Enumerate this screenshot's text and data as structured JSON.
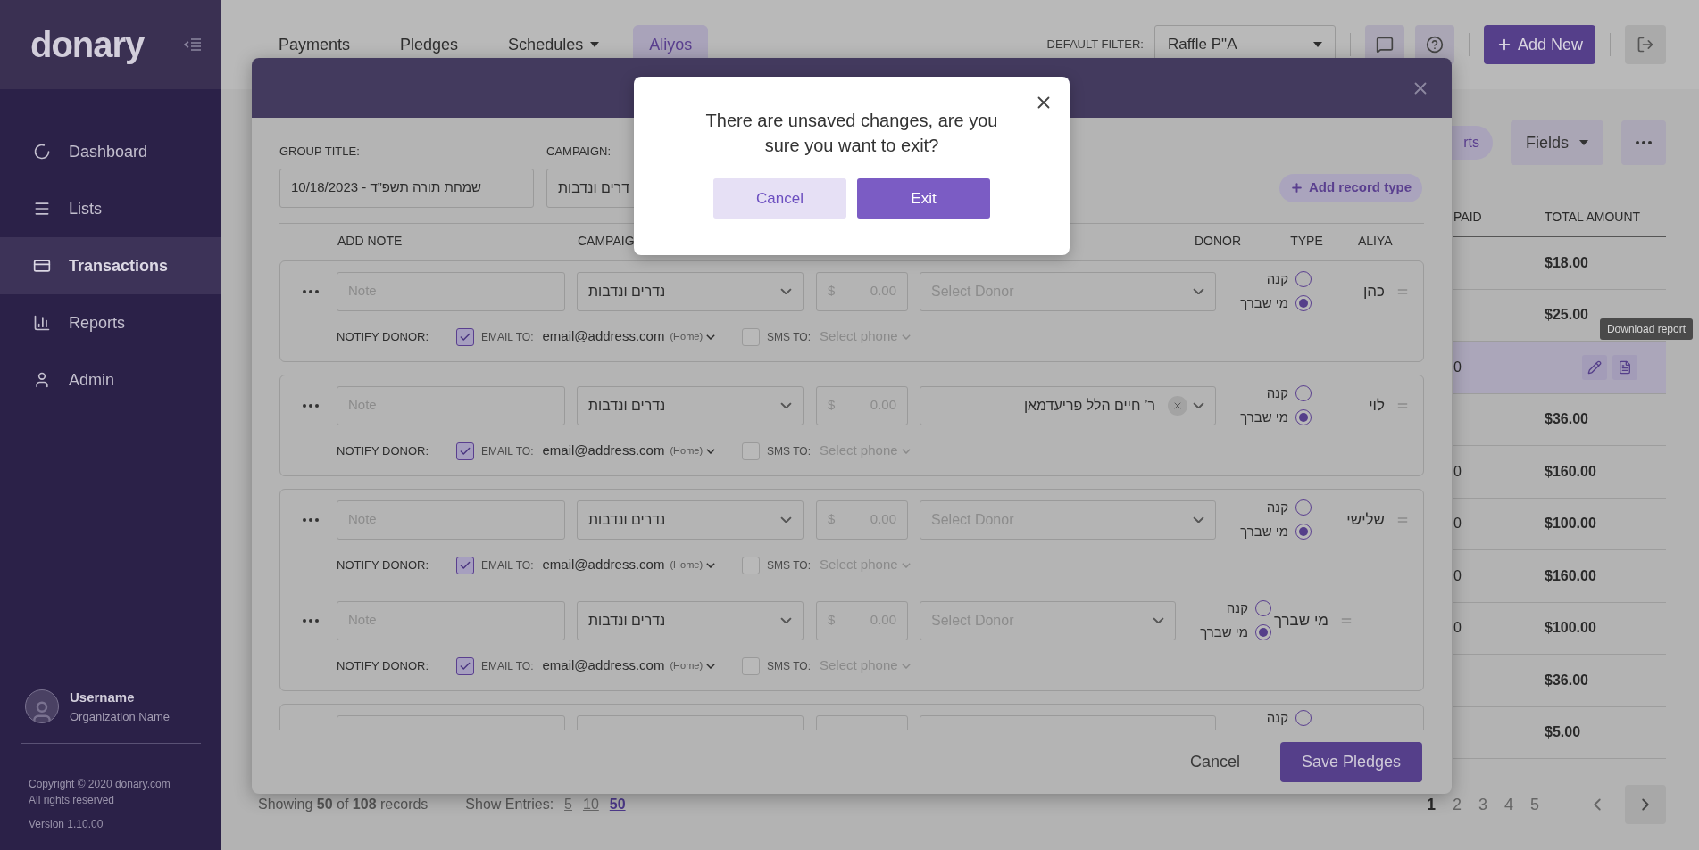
{
  "sidebar": {
    "logo": "donary",
    "items": [
      {
        "label": "Dashboard",
        "selected": false
      },
      {
        "label": "Lists",
        "selected": false
      },
      {
        "label": "Transactions",
        "selected": true
      },
      {
        "label": "Reports",
        "selected": false
      },
      {
        "label": "Admin",
        "selected": false
      }
    ],
    "user": {
      "name": "Username",
      "organization": "Organization Name"
    },
    "copyright": "Copyright © 2020 donary.com",
    "rights": "All rights reserved",
    "version": "Version 1.10.00"
  },
  "tabs": [
    {
      "label": "Payments",
      "selected": false,
      "dropdown": false
    },
    {
      "label": "Pledges",
      "selected": false,
      "dropdown": false
    },
    {
      "label": "Schedules",
      "selected": false,
      "dropdown": true
    },
    {
      "label": "Aliyos",
      "selected": true,
      "dropdown": false
    }
  ],
  "default_filter": {
    "label": "DEFAULT FILTER:",
    "value": "Raffle P\"A"
  },
  "add_new": "Add New",
  "toolbar": {
    "pill_fragment": "rts",
    "fields": "Fields"
  },
  "table": {
    "columns": [
      "PAID",
      "TOTAL AMOUNT"
    ],
    "rows": [
      {
        "total": "$18.00",
        "selected": false
      },
      {
        "total": "$25.00",
        "selected": false
      },
      {
        "paid": "0",
        "selected": true,
        "tooltip": "Download report"
      },
      {
        "total": "$36.00",
        "selected": false
      },
      {
        "paid": "0",
        "total": "$160.00",
        "selected": false
      },
      {
        "paid": "0",
        "total": "$100.00",
        "selected": false
      },
      {
        "paid": "0",
        "total": "$160.00",
        "selected": false
      },
      {
        "paid": "0",
        "total": "$100.00",
        "selected": false
      },
      {
        "total": "$36.00",
        "selected": false
      },
      {
        "total": "$5.00",
        "selected": false
      }
    ]
  },
  "pagination": {
    "pages": [
      {
        "label": "1",
        "selected": true
      },
      {
        "label": "2",
        "selected": false
      },
      {
        "label": "3",
        "selected": false
      },
      {
        "label": "4",
        "selected": false
      },
      {
        "label": "5",
        "selected": false
      }
    ]
  },
  "records": {
    "showing": "Showing **50** of **108** records",
    "entries_label": "Show Entries:",
    "entries": [
      {
        "label": "5",
        "selected": false
      },
      {
        "label": "10",
        "selected": false
      },
      {
        "label": "50",
        "selected": true
      }
    ]
  },
  "modal": {
    "group_title_label": "GROUP TITLE:",
    "group_title": "שמחת תורה תשפ”ד - 10/18/2023",
    "campaign_label": "CAMPAIGN:",
    "campaign": "דרים ונדבות",
    "add_record_type": "Add record type",
    "columns": {
      "note": "ADD NOTE",
      "campaign": "CAMPAIG",
      "donor": "DONOR",
      "type": "TYPE",
      "aliya": "ALIYA"
    },
    "rows": [
      {
        "aliya": "כהן",
        "note_placeholder": "Note",
        "campaign": "נדרים ונדבות",
        "currency": "$",
        "amount_placeholder": "0.00",
        "donor_placeholder": "Select Donor",
        "types": [
          {
            "label": "קנה",
            "selected": false
          },
          {
            "label": "מי שברך",
            "selected": true
          }
        ],
        "notify": {
          "label": "NOTIFY DONOR:",
          "email_checked": true,
          "email_label": "EMAIL TO:",
          "email": "email@address.com",
          "email_tag": "(Home)",
          "sms_checked": false,
          "sms_label": "SMS TO:",
          "sms_placeholder": "Select phone"
        }
      },
      {
        "aliya": "לוי",
        "note_placeholder": "Note",
        "campaign": "נדרים ונדבות",
        "currency": "$",
        "amount_placeholder": "0.00",
        "donor": "ר’ חיים הלל פריעדמאן",
        "types": [
          {
            "label": "קנה",
            "selected": false
          },
          {
            "label": "מי שברך",
            "selected": true
          }
        ],
        "notify": {
          "label": "NOTIFY DONOR:",
          "email_checked": true,
          "email_label": "EMAIL TO:",
          "email": "email@address.com",
          "email_tag": "(Home)",
          "sms_checked": false,
          "sms_label": "SMS TO:",
          "sms_placeholder": "Select phone"
        }
      },
      {
        "aliya": "שלישי",
        "note_placeholder": "Note",
        "campaign": "נדרים ונדבות",
        "currency": "$",
        "amount_placeholder": "0.00",
        "donor_placeholder": "Select Donor",
        "types": [
          {
            "label": "קנה",
            "selected": false
          },
          {
            "label": "מי שברך",
            "selected": true
          }
        ],
        "notify": {
          "label": "NOTIFY DONOR:",
          "email_checked": true,
          "email_label": "EMAIL TO:",
          "email": "email@address.com",
          "email_tag": "(Home)",
          "sms_checked": false,
          "sms_label": "SMS TO:",
          "sms_placeholder": "Select phone"
        },
        "children": [
          {
            "aliya": "מי שברך",
            "note_placeholder": "Note",
            "campaign": "נדרים ונדבות",
            "currency": "$",
            "amount_placeholder": "0.00",
            "donor_placeholder": "Select Donor",
            "types": [
              {
                "label": "קנה",
                "selected": false
              },
              {
                "label": "מי שברך",
                "selected": true
              }
            ],
            "notify": {
              "label": "NOTIFY DONOR:",
              "email_checked": true,
              "email_label": "EMAIL TO:",
              "email": "email@address.com",
              "email_tag": "(Home)",
              "sms_checked": false,
              "sms_label": "SMS TO:",
              "sms_placeholder": "Select phone"
            }
          }
        ]
      },
      {
        "types": [
          {
            "label": "קנה",
            "selected": false
          }
        ]
      }
    ],
    "cancel": "Cancel",
    "save": "Save Pledges"
  },
  "confirm": {
    "message": "There are unsaved changes, are you sure you want to exit?",
    "cancel": "Cancel",
    "exit": "Exit"
  }
}
